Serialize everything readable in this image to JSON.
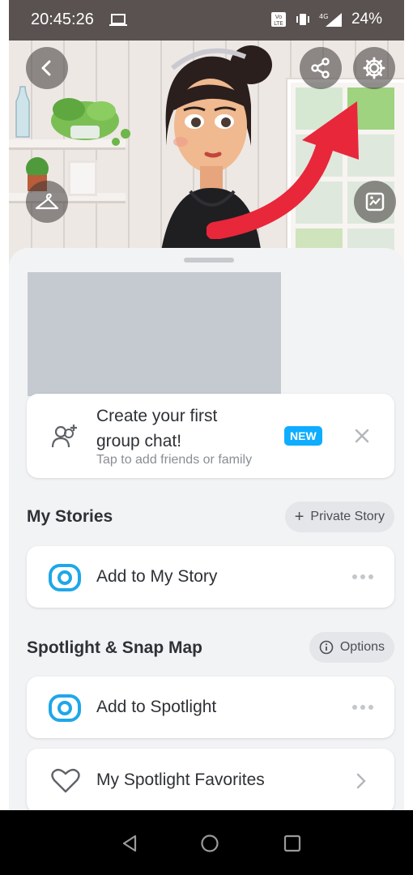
{
  "status_bar": {
    "time": "20:45:26",
    "battery": "24%",
    "network": "4G",
    "volte": "VoLTE"
  },
  "header": {
    "back_icon": "chevron-left-icon",
    "share_icon": "share-icon",
    "settings_icon": "gear-icon",
    "outfit_icon": "hanger-icon",
    "background_icon": "picture-frame-icon",
    "arrow_color": "#e8273b"
  },
  "group_chat_card": {
    "title_line1": "Create your first",
    "title_line2": "group chat!",
    "subtitle": "Tap to add friends or family",
    "badge": "NEW"
  },
  "my_stories": {
    "title": "My Stories",
    "action_label": "Private Story",
    "action_prefix": "+",
    "add_label": "Add to My Story"
  },
  "spotlight": {
    "title": "Spotlight & Snap Map",
    "options_label": "Options",
    "add_label": "Add to Spotlight",
    "favorites_label": "My Spotlight Favorites"
  },
  "colors": {
    "accent_blue": "#0fadff",
    "camera_icon": "#1fa7e8"
  }
}
